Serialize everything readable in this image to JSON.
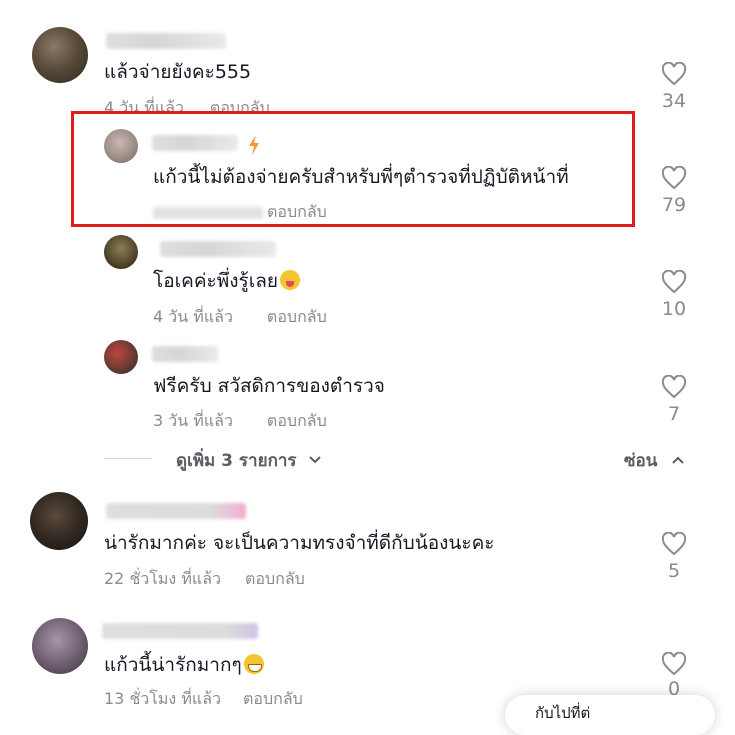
{
  "comments": [
    {
      "text": "แล้วจ่ายยังคะ555",
      "time": "4 วัน ที่แล้ว",
      "reply": "ตอบกลับ",
      "likes": "34"
    },
    {
      "text": "แก้วนี้ไม่ต้องจ่ายครับสำหรับพี่ๆตำรวจที่ปฏิบัติหน้าที่",
      "time": "",
      "reply": "ตอบกลับ",
      "likes": "79"
    },
    {
      "text": "โอเคค่ะพึ่งรู้เลย",
      "time": "4 วัน ที่แล้ว",
      "reply": "ตอบกลับ",
      "likes": "10",
      "emoji": "squinting-tongue-emoji"
    },
    {
      "text": "ฟรีครับ สวัสดิการของตำรวจ",
      "time": "3 วัน ที่แล้ว",
      "reply": "ตอบกลับ",
      "likes": "7"
    },
    {
      "text": "น่ารักมากค่ะ จะเป็นความทรงจำที่ดีกับน้องนะคะ",
      "time": "22 ชั่วโมง ที่แล้ว",
      "reply": "ตอบกลับ",
      "likes": "5"
    },
    {
      "text": "แก้วนี้น่ารักมากๆ",
      "time": "13 ชั่วโมง ที่แล้ว",
      "reply": "ตอบกลับ",
      "likes": "0",
      "emoji": "grinning-emoji"
    }
  ],
  "thread": {
    "view_more": "ดูเพิ่ม 3 รายการ",
    "hide": "ซ่อน"
  },
  "bottom_pill": {
    "text": "กับไปที่ต่"
  },
  "colors": {
    "highlight": "#e21b1b",
    "meta_gray": "#8a8b91",
    "text": "#161823"
  }
}
